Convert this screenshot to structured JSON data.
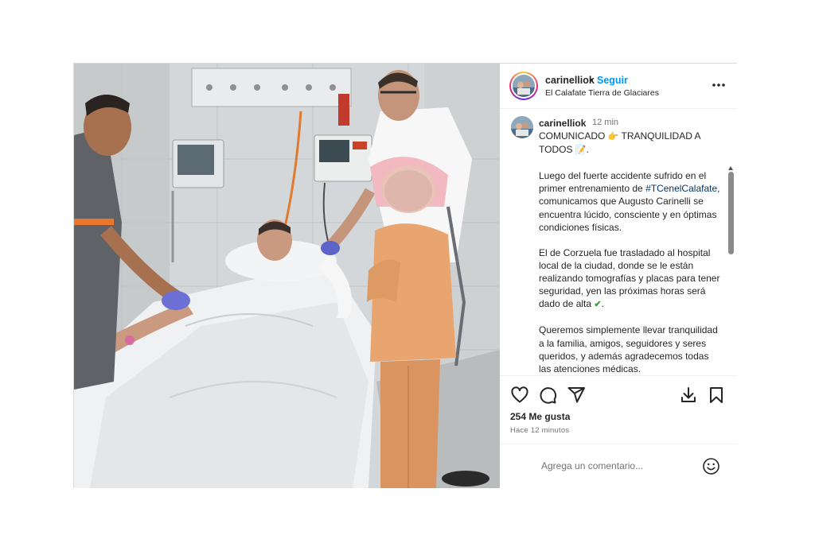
{
  "header": {
    "username": "carinelliok",
    "separator": "•",
    "follow_label": "Seguir",
    "location": "El Calafate Tierra de Glaciares",
    "more_icon": "more-horizontal-icon"
  },
  "caption": {
    "username": "carinelliok",
    "time": "12 min",
    "line1_a": "COMUNICADO",
    "line1_b": "TRANQUILIDAD A",
    "line2": "TODOS",
    "p2_a": "Luego del fuerte accidente sufrido en el primer entrenamiento de",
    "hashtag": "#TCenelCalafate",
    "p2_b": ", comunicamos que Augusto Carinelli se encuentra lúcido, consciente y en óptimas condiciones físicas.",
    "p3_a": "El de Corzuela fue trasladado al hospital local de la ciudad, donde se le están realizando tomografías y placas para tener seguridad, yen las próximas horas será dado de alta",
    "p4": "Queremos simplemente llevar tranquilidad a la familia, amigos, seguidores y seres queridos, y además agradecemos todas las atenciones médicas."
  },
  "actions": {
    "icons": [
      "heart-icon",
      "comment-icon",
      "share-icon",
      "download-icon",
      "bookmark-icon"
    ],
    "likes": "254 Me gusta",
    "time_ago": "Hace 12 minutos"
  },
  "comment": {
    "placeholder": "Agrega un comentario..."
  },
  "colors": {
    "accent_blue": "#0095f6",
    "hashtag": "#00376b",
    "secondary_text": "#737373",
    "border": "#dbdbdb"
  }
}
